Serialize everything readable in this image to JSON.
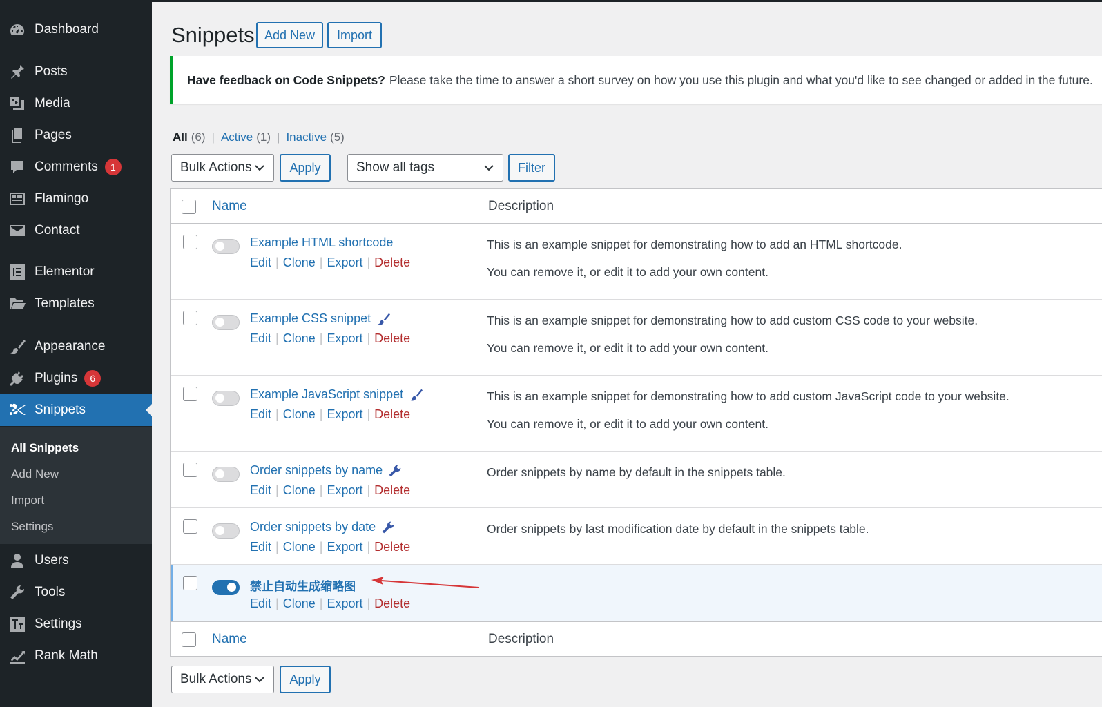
{
  "sidebar": {
    "items": [
      {
        "label": "Dashboard",
        "icon": "dashboard-icon"
      },
      {
        "label": "Posts",
        "icon": "pin-icon"
      },
      {
        "label": "Media",
        "icon": "media-icon"
      },
      {
        "label": "Pages",
        "icon": "pages-icon"
      },
      {
        "label": "Comments",
        "icon": "comments-icon",
        "badge": "1"
      },
      {
        "label": "Flamingo",
        "icon": "flamingo-icon"
      },
      {
        "label": "Contact",
        "icon": "mail-icon"
      },
      {
        "label": "Elementor",
        "icon": "elementor-icon"
      },
      {
        "label": "Templates",
        "icon": "folder-icon"
      },
      {
        "label": "Appearance",
        "icon": "brush-icon"
      },
      {
        "label": "Plugins",
        "icon": "plugin-icon",
        "badge": "6"
      },
      {
        "label": "Snippets",
        "icon": "scissors-icon"
      },
      {
        "label": "Users",
        "icon": "users-icon"
      },
      {
        "label": "Tools",
        "icon": "wrench-icon"
      },
      {
        "label": "Settings",
        "icon": "settings-icon"
      },
      {
        "label": "Rank Math",
        "icon": "rank-math-icon"
      }
    ],
    "submenu": [
      "All Snippets",
      "Add New",
      "Import",
      "Settings"
    ]
  },
  "header": {
    "title": "Snippets",
    "add_new": "Add New",
    "import": "Import"
  },
  "notice": {
    "strong": "Have feedback on Code Snippets?",
    "text": "Please take the time to answer a short survey on how you use this plugin and what you'd like to see changed or added in the future."
  },
  "views": {
    "all": "All",
    "all_count": "(6)",
    "active": "Active",
    "active_count": "(1)",
    "inactive": "Inactive",
    "inactive_count": "(5)",
    "sep": "|"
  },
  "filters": {
    "bulk_actions": "Bulk Actions",
    "apply": "Apply",
    "tags": "Show all tags",
    "filter": "Filter"
  },
  "table": {
    "col_name": "Name",
    "col_desc": "Description",
    "actions": {
      "edit": "Edit",
      "clone": "Clone",
      "export": "Export",
      "delete": "Delete"
    },
    "rows": [
      {
        "name": "Example HTML shortcode",
        "active": false,
        "icon": "",
        "desc1": "This is an example snippet for demonstrating how to add an HTML shortcode.",
        "desc2": "You can remove it, or edit it to add your own content."
      },
      {
        "name": "Example CSS snippet",
        "active": false,
        "icon": "brush-icon",
        "desc1": "This is an example snippet for demonstrating how to add custom CSS code to your website.",
        "desc2": "You can remove it, or edit it to add your own content."
      },
      {
        "name": "Example JavaScript snippet",
        "active": false,
        "icon": "brush-icon",
        "desc1": "This is an example snippet for demonstrating how to add custom JavaScript code to your website.",
        "desc2": "You can remove it, or edit it to add your own content."
      },
      {
        "name": "Order snippets by name",
        "active": false,
        "icon": "wrench-icon",
        "desc1": "Order snippets by name by default in the snippets table.",
        "desc2": ""
      },
      {
        "name": "Order snippets by date",
        "active": false,
        "icon": "wrench-icon",
        "desc1": "Order snippets by last modification date by default in the snippets table.",
        "desc2": ""
      },
      {
        "name": "禁止自动生成缩略图",
        "active": true,
        "icon": "",
        "desc1": "",
        "desc2": ""
      }
    ]
  },
  "colors": {
    "sidebar_bg": "#1d2327",
    "accent": "#2271b1",
    "delete": "#b32d2e",
    "notice_border": "#00a32a",
    "badge": "#d63638",
    "arrow": "#d63638"
  }
}
